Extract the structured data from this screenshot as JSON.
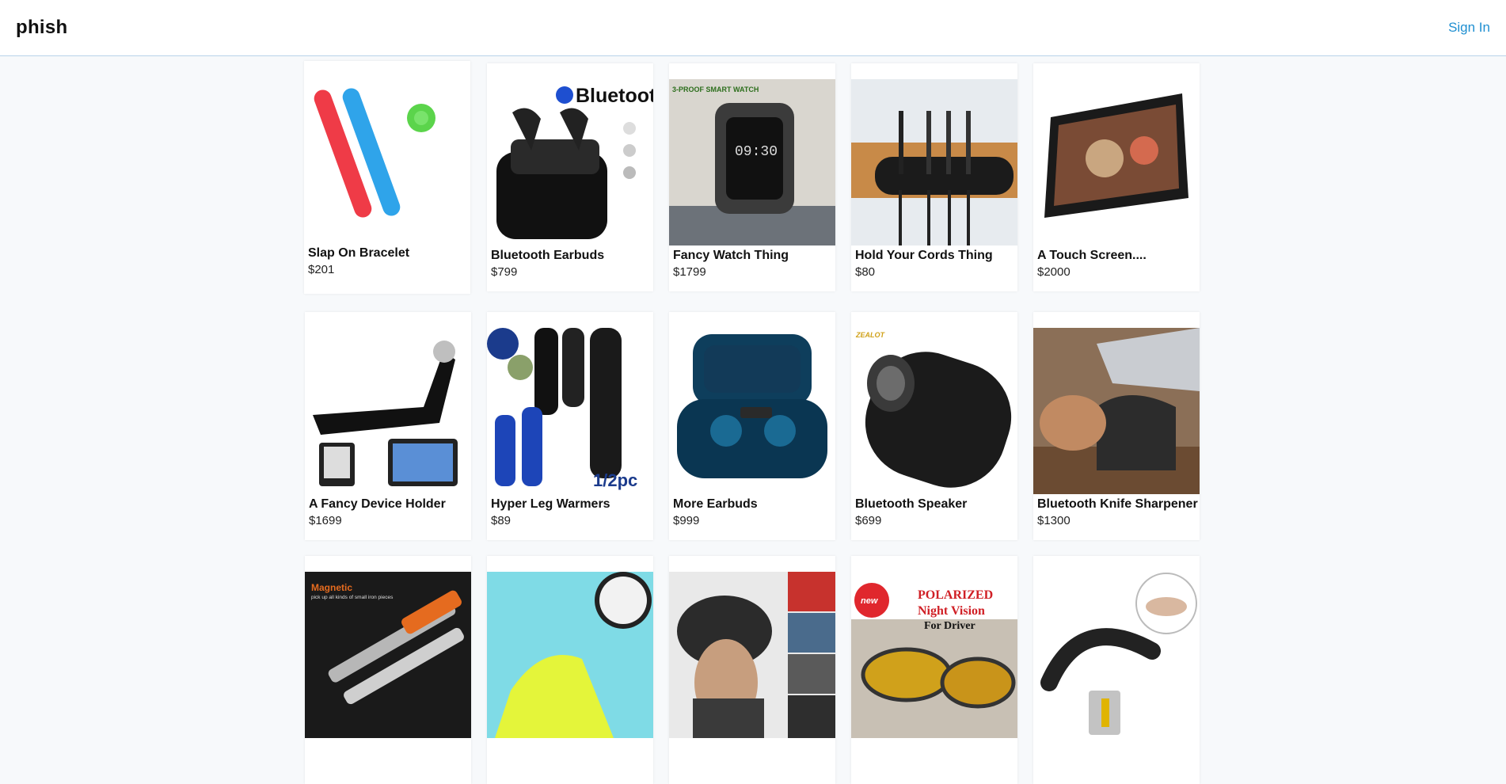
{
  "header": {
    "brand": "phish",
    "signin_label": "Sign In"
  },
  "products": [
    {
      "name": "Slap On Bracelet",
      "price": "$201",
      "icon": "slap-bracelet-image"
    },
    {
      "name": "Bluetooth Earbuds",
      "price": "$799",
      "icon": "earbuds-image",
      "image_text": "Bluetooth"
    },
    {
      "name": "Fancy Watch Thing",
      "price": "$1799",
      "icon": "smart-watch-image",
      "image_text": "3-PROOF SMART WATCH"
    },
    {
      "name": "Hold Your Cords Thing",
      "price": "$80",
      "icon": "cord-holder-image"
    },
    {
      "name": "A Touch Screen....",
      "price": "$2000",
      "icon": "screen-magnifier-image"
    },
    {
      "name": "A Fancy Device Holder",
      "price": "$1699",
      "icon": "device-holder-image"
    },
    {
      "name": "Hyper Leg Warmers",
      "price": "$89",
      "icon": "leg-warmers-image",
      "image_text": "1/2pc"
    },
    {
      "name": "More Earbuds",
      "price": "$999",
      "icon": "earbuds-case-image"
    },
    {
      "name": "Bluetooth Speaker",
      "price": "$699",
      "icon": "speaker-image",
      "image_text": "ZEALOT"
    },
    {
      "name": "Bluetooth Knife Sharpener",
      "price": "$1300",
      "icon": "knife-sharpener-image"
    },
    {
      "name": "",
      "price": "",
      "icon": "magnetic-pickup-tool-image",
      "image_text": "Magnetic",
      "image_subtext": "pick up all kinds of small iron pieces"
    },
    {
      "name": "",
      "price": "",
      "icon": "shoe-cover-image"
    },
    {
      "name": "",
      "price": "",
      "icon": "winter-hat-image"
    },
    {
      "name": "",
      "price": "",
      "icon": "night-vision-glasses-image",
      "image_text": "POLARIZED",
      "image_text2": "Night Vision",
      "image_text3": "For Driver",
      "badge": "new"
    },
    {
      "name": "",
      "price": "",
      "icon": "usb-bracelet-image"
    }
  ]
}
